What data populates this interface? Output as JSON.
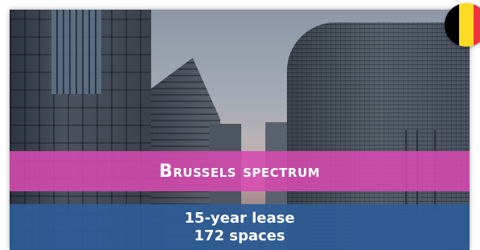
{
  "card": {
    "title": "Brussels spectrum",
    "details": [
      "15-year lease",
      "172 spaces"
    ]
  },
  "badge": {
    "icon": "belgium-flag-icon",
    "colors": [
      "#000000",
      "#FDDA24",
      "#EF3340"
    ]
  },
  "colors": {
    "title_band": "#D64AB0",
    "info_band": "#2C5C96"
  }
}
